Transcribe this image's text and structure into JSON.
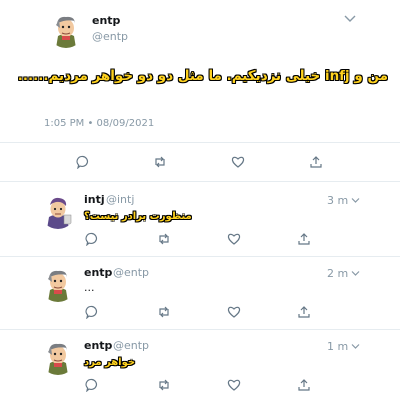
{
  "main_tweet": {
    "name": "entp",
    "handle": "@entp",
    "text": "من و infj خیلی نزدیکیم. ما مثل دو دو خواهر مردیم......",
    "timestamp": "1:05 PM • 08/09/2021"
  },
  "replies": [
    {
      "name": "intj",
      "handle": "@intj",
      "time": "3 m",
      "text": "منظورت برادر نیست؟"
    },
    {
      "name": "entp",
      "handle": "@entp",
      "time": "2 m",
      "text": "..."
    },
    {
      "name": "entp",
      "handle": "@entp",
      "time": "1 m",
      "text": "خواهر مرد"
    }
  ],
  "colors": {
    "caption_fill": "#ffd21e",
    "icon_gray": "#657786",
    "handle_gray": "#8899a6",
    "divider": "#e6ecf0"
  },
  "icons": {
    "reply": "comment-bubble-icon",
    "retweet": "retweet-icon",
    "like": "heart-icon",
    "share": "share-upload-icon",
    "menu": "chevron-down-icon"
  }
}
